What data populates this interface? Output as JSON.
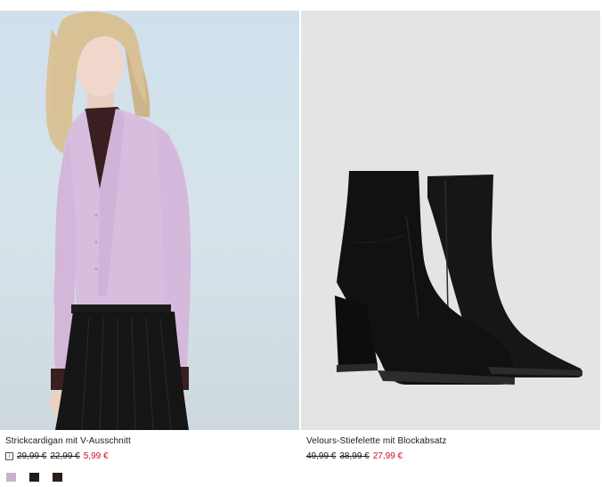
{
  "products": [
    {
      "name": "Strickcardigan mit V-Ausschnitt",
      "info_icon": "info-icon",
      "prices": {
        "original": "29,99 €",
        "previous": "22,99 €",
        "current": "5,99 €"
      },
      "swatches": [
        {
          "color": "#c9b3cc"
        },
        {
          "color": "#1d1d1d"
        },
        {
          "color": "#2a1c18"
        }
      ]
    },
    {
      "name": "Velours-Stiefelette mit Blockabsatz",
      "prices": {
        "original": "49,99 €",
        "previous": "38,99 €",
        "current": "27,99 €"
      }
    }
  ],
  "colors": {
    "sale_price": "#c8102e",
    "text": "#1a1a1a"
  }
}
